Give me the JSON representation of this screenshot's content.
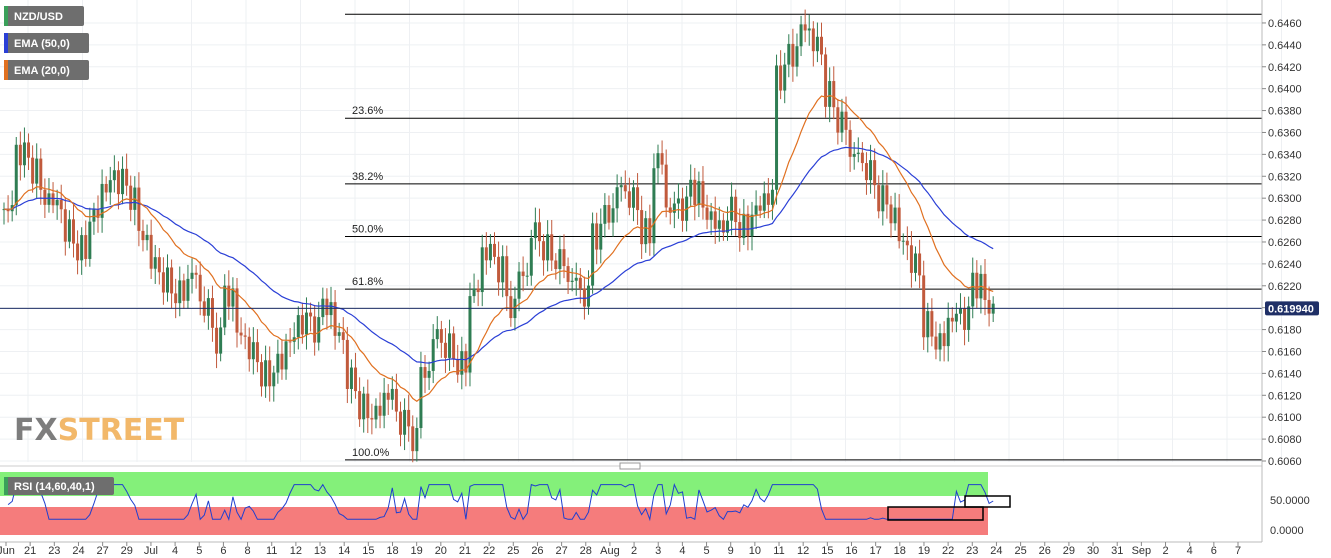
{
  "chart_data": {
    "type": "candlestick",
    "symbol": "NZD/USD",
    "indicators": [
      {
        "name": "EMA (50,0)",
        "color": "#2a3fd6"
      },
      {
        "name": "EMA (20,0)",
        "color": "#e07020"
      }
    ],
    "price_axis": {
      "ylim": [
        0.606,
        0.647
      ],
      "ticks": [
        "0.6460",
        "0.6440",
        "0.6420",
        "0.6400",
        "0.6380",
        "0.6360",
        "0.6340",
        "0.6320",
        "0.6300",
        "0.6280",
        "0.6260",
        "0.6240",
        "0.6220",
        "0.6200",
        "0.6180",
        "0.6160",
        "0.6140",
        "0.6120",
        "0.6100",
        "0.6080",
        "0.6060"
      ]
    },
    "current_price": "0.619940",
    "current_price_value": 0.61994,
    "fibonacci": [
      {
        "label": "23.6%",
        "value": 0.6373
      },
      {
        "label": "38.2%",
        "value": 0.6313
      },
      {
        "label": "50.0%",
        "value": 0.6265
      },
      {
        "label": "61.8%",
        "value": 0.6217
      },
      {
        "label": "100.0%",
        "value": 0.6061
      }
    ],
    "fib_top_value": 0.6468,
    "x_labels": [
      "Jun",
      "21",
      "23",
      "24",
      "27",
      "29",
      "Jul",
      "4",
      "5",
      "6",
      "8",
      "11",
      "12",
      "13",
      "14",
      "15",
      "18",
      "19",
      "20",
      "21",
      "22",
      "25",
      "26",
      "27",
      "28",
      "Aug",
      "2",
      "3",
      "4",
      "5",
      "9",
      "10",
      "11",
      "12",
      "15",
      "16",
      "17",
      "18",
      "19",
      "22",
      "23",
      "24",
      "25",
      "26",
      "29",
      "30",
      "31",
      "Sep",
      "2",
      "4",
      "6",
      "7"
    ],
    "price_series": [
      0.629,
      0.634,
      0.6325,
      0.63,
      0.6295,
      0.627,
      0.6255,
      0.6285,
      0.631,
      0.6315,
      0.63,
      0.6265,
      0.624,
      0.6225,
      0.6215,
      0.623,
      0.62,
      0.617,
      0.621,
      0.6175,
      0.616,
      0.614,
      0.615,
      0.617,
      0.6185,
      0.618,
      0.62,
      0.6175,
      0.6135,
      0.611,
      0.6105,
      0.612,
      0.6095,
      0.608,
      0.614,
      0.6175,
      0.6165,
      0.615,
      0.6215,
      0.625,
      0.6235,
      0.62,
      0.623,
      0.627,
      0.6255,
      0.6245,
      0.6225,
      0.621,
      0.6265,
      0.6285,
      0.631,
      0.63,
      0.627,
      0.6335,
      0.629,
      0.629,
      0.6305,
      0.6285,
      0.6275,
      0.629,
      0.6275,
      0.629,
      0.63,
      0.641,
      0.643,
      0.6455,
      0.644,
      0.6395,
      0.637,
      0.634,
      0.6325,
      0.63,
      0.6285,
      0.626,
      0.624,
      0.6185,
      0.617,
      0.619,
      0.619,
      0.622,
      0.62
    ],
    "rsi": {
      "label": "RSI (14,60,40,1)",
      "levels": [
        "50.0000",
        "0.0000"
      ],
      "upper": 60,
      "lower": 40
    },
    "watermark": "FXSTREET"
  }
}
